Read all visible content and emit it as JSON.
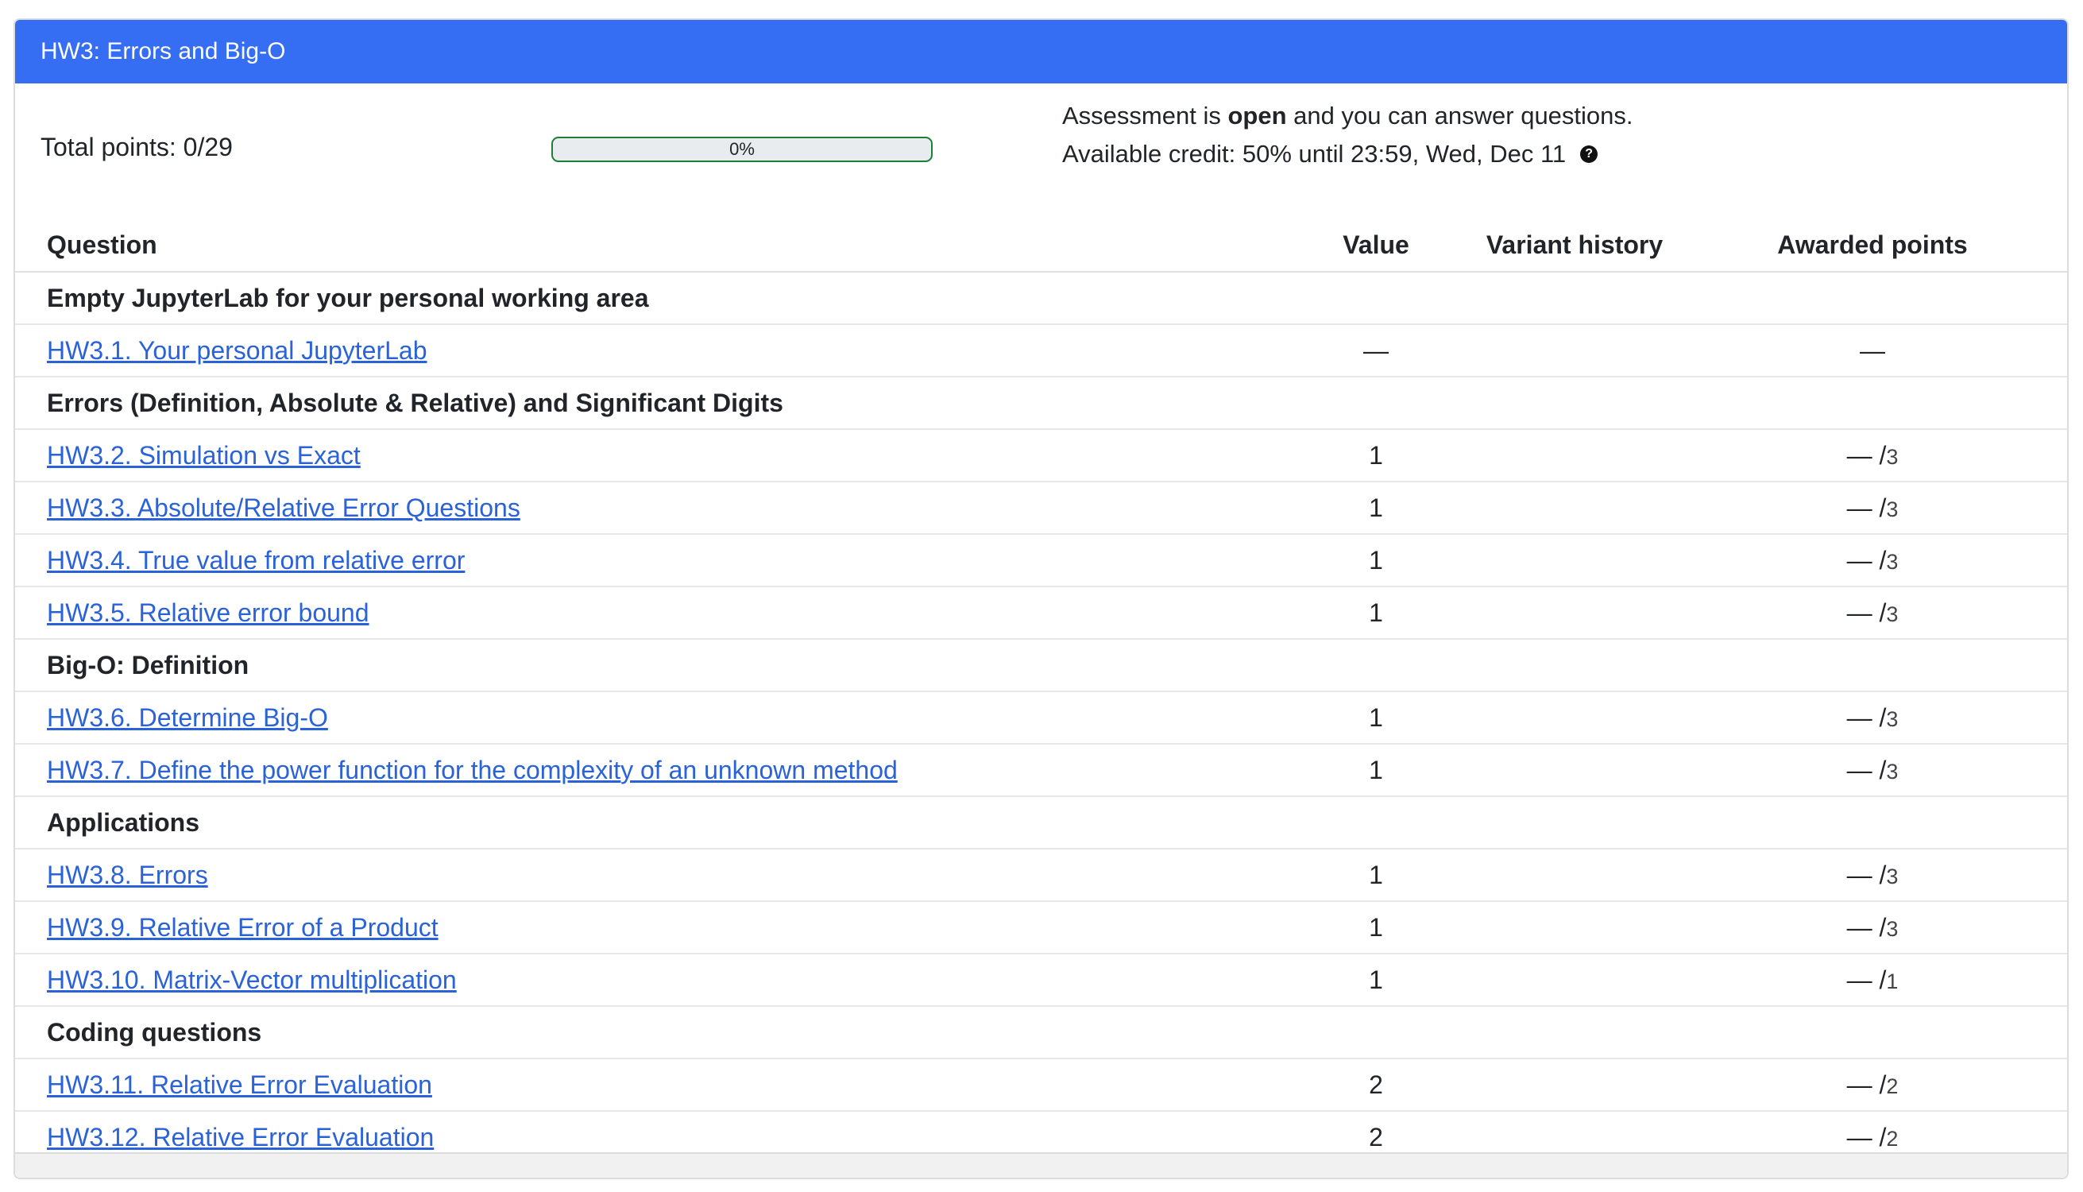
{
  "header": {
    "title": "HW3: Errors and Big-O"
  },
  "summary": {
    "total_points": "Total points: 0/29",
    "progress_label": "0%",
    "progress_fraction": 0,
    "status_prefix": "Assessment is ",
    "status_bold": "open",
    "status_suffix": " and you can answer questions.",
    "credit": "Available credit: 50% until 23:59, Wed, Dec 11",
    "help_icon": "?"
  },
  "table": {
    "headers": {
      "question": "Question",
      "value": "Value",
      "variant_history": "Variant history",
      "awarded_points": "Awarded points"
    },
    "rows": [
      {
        "type": "section",
        "title": "Empty JupyterLab for your personal working area"
      },
      {
        "type": "question",
        "title": "HW3.1. Your personal JupyterLab",
        "value": "—",
        "awarded": "—",
        "max": ""
      },
      {
        "type": "section",
        "title": "Errors (Definition, Absolute & Relative) and Significant Digits"
      },
      {
        "type": "question",
        "title": "HW3.2. Simulation vs Exact",
        "value": "1",
        "awarded": "— /",
        "max": "3"
      },
      {
        "type": "question",
        "title": "HW3.3. Absolute/Relative Error Questions",
        "value": "1",
        "awarded": "— /",
        "max": "3"
      },
      {
        "type": "question",
        "title": "HW3.4. True value from relative error",
        "value": "1",
        "awarded": "— /",
        "max": "3"
      },
      {
        "type": "question",
        "title": "HW3.5. Relative error bound",
        "value": "1",
        "awarded": "— /",
        "max": "3"
      },
      {
        "type": "section",
        "title": "Big-O: Definition"
      },
      {
        "type": "question",
        "title": "HW3.6. Determine Big-O",
        "value": "1",
        "awarded": "— /",
        "max": "3"
      },
      {
        "type": "question",
        "title": "HW3.7. Define the power function for the complexity of an unknown method",
        "value": "1",
        "awarded": "— /",
        "max": "3"
      },
      {
        "type": "section",
        "title": "Applications"
      },
      {
        "type": "question",
        "title": "HW3.8. Errors",
        "value": "1",
        "awarded": "— /",
        "max": "3"
      },
      {
        "type": "question",
        "title": "HW3.9. Relative Error of a Product",
        "value": "1",
        "awarded": "— /",
        "max": "3"
      },
      {
        "type": "question",
        "title": "HW3.10. Matrix-Vector multiplication",
        "value": "1",
        "awarded": "— /",
        "max": "1"
      },
      {
        "type": "section",
        "title": "Coding questions"
      },
      {
        "type": "question",
        "title": "HW3.11. Relative Error Evaluation",
        "value": "2",
        "awarded": "— /",
        "max": "2"
      },
      {
        "type": "question",
        "title": "HW3.12. Relative Error Evaluation",
        "value": "2",
        "awarded": "— /",
        "max": "2"
      }
    ]
  },
  "colors": {
    "header_bg": "#356df3",
    "link": "#2a62d8",
    "progress_border": "#1a7f37"
  }
}
